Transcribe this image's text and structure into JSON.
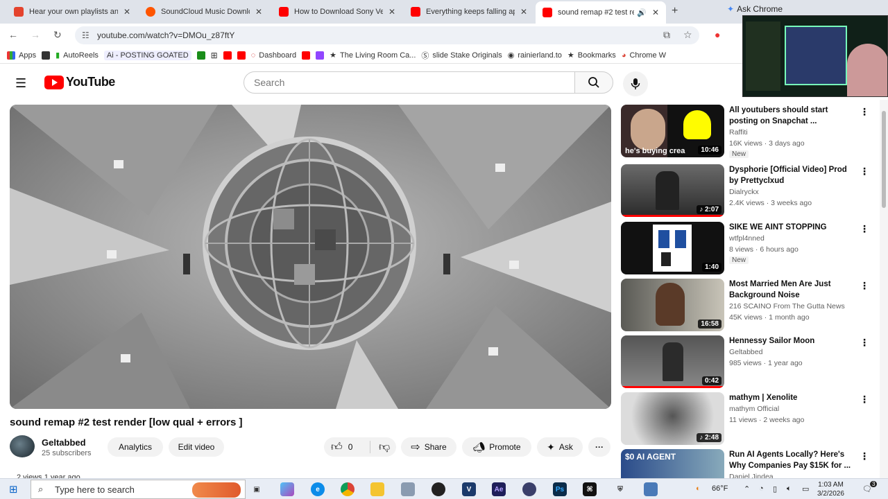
{
  "tabs": [
    {
      "title": "Hear your own playlists an",
      "color": "#e4432d"
    },
    {
      "title": "SoundCloud Music Downlo",
      "color": "#ff5500"
    },
    {
      "title": "How to Download Sony Ve",
      "color": "#ff0000"
    },
    {
      "title": "Everything keeps falling ap",
      "color": "#ff0000"
    },
    {
      "title": "sound remap #2 test re",
      "color": "#ff0000"
    }
  ],
  "ask_chrome": "Ask Chrome",
  "url": "youtube.com/watch?v=DMOu_z87ftY",
  "bookmarks": [
    {
      "label": "Apps"
    },
    {
      "label": ""
    },
    {
      "label": "AutoReels"
    },
    {
      "label": "Ai - POSTING GOATED"
    },
    {
      "label": ""
    },
    {
      "label": ""
    },
    {
      "label": ""
    },
    {
      "label": ""
    },
    {
      "label": "Dashboard"
    },
    {
      "label": ""
    },
    {
      "label": ""
    },
    {
      "label": "The Living Room Ca..."
    },
    {
      "label": "slide Stake Originals"
    },
    {
      "label": "rainierland.to"
    },
    {
      "label": "Bookmarks"
    },
    {
      "label": "Chrome W"
    }
  ],
  "header": {
    "logo": "YouTube",
    "search_placeholder": "Search"
  },
  "video": {
    "title": "sound remap #2 test render [low qual + errors ]",
    "channel": "Geltabbed",
    "subscribers": "25 subscribers",
    "analytics": "Analytics",
    "edit": "Edit video",
    "likes": "0",
    "share": "Share",
    "promote": "Promote",
    "ask": "Ask",
    "views_line": "2 views  1 year ago"
  },
  "recommendations": [
    {
      "title": "All youtubers should start posting on Snapchat ...",
      "channel": "Raffiti",
      "stats": "16K views · 3 days ago",
      "new": "New",
      "duration": "10:46",
      "thumb_text": "he's buying crea"
    },
    {
      "title": "Dysphorie [Official Video] Prod by Prettyclxud",
      "channel": "Dialryckx",
      "stats": "2.4K views · 3 weeks ago",
      "new": "",
      "duration": "2:07",
      "thumb_text": ""
    },
    {
      "title": "SIKE WE AINT STOPPING",
      "channel": "wtfpl4nned",
      "stats": "8 views · 6 hours ago",
      "new": "New",
      "duration": "1:40",
      "thumb_text": ""
    },
    {
      "title": "Most Married Men Are Just Background Noise",
      "channel": "216 SCAINO From The Gutta News",
      "stats": "45K views · 1 month ago",
      "new": "",
      "duration": "16:58",
      "thumb_text": ""
    },
    {
      "title": "Hennessy Sailor Moon",
      "channel": "Geltabbed",
      "stats": "985 views · 1 year ago",
      "new": "",
      "duration": "0:42",
      "thumb_text": ""
    },
    {
      "title": "mathym | Xenolite",
      "channel": "mathym Official",
      "stats": "11 views · 2 weeks ago",
      "new": "",
      "duration": "2:48",
      "thumb_text": ""
    },
    {
      "title": "Run AI Agents Locally? Here's Why Companies Pay $15K for ...",
      "channel": "Daniel Jindea",
      "stats": "",
      "new": "",
      "duration": "",
      "thumb_text": "$0 AI AGENT"
    }
  ],
  "taskbar": {
    "search_placeholder": "Type here to search",
    "weather": "66°F",
    "time": "1:03 AM",
    "date": "3/2/2026",
    "notifications": "3"
  }
}
